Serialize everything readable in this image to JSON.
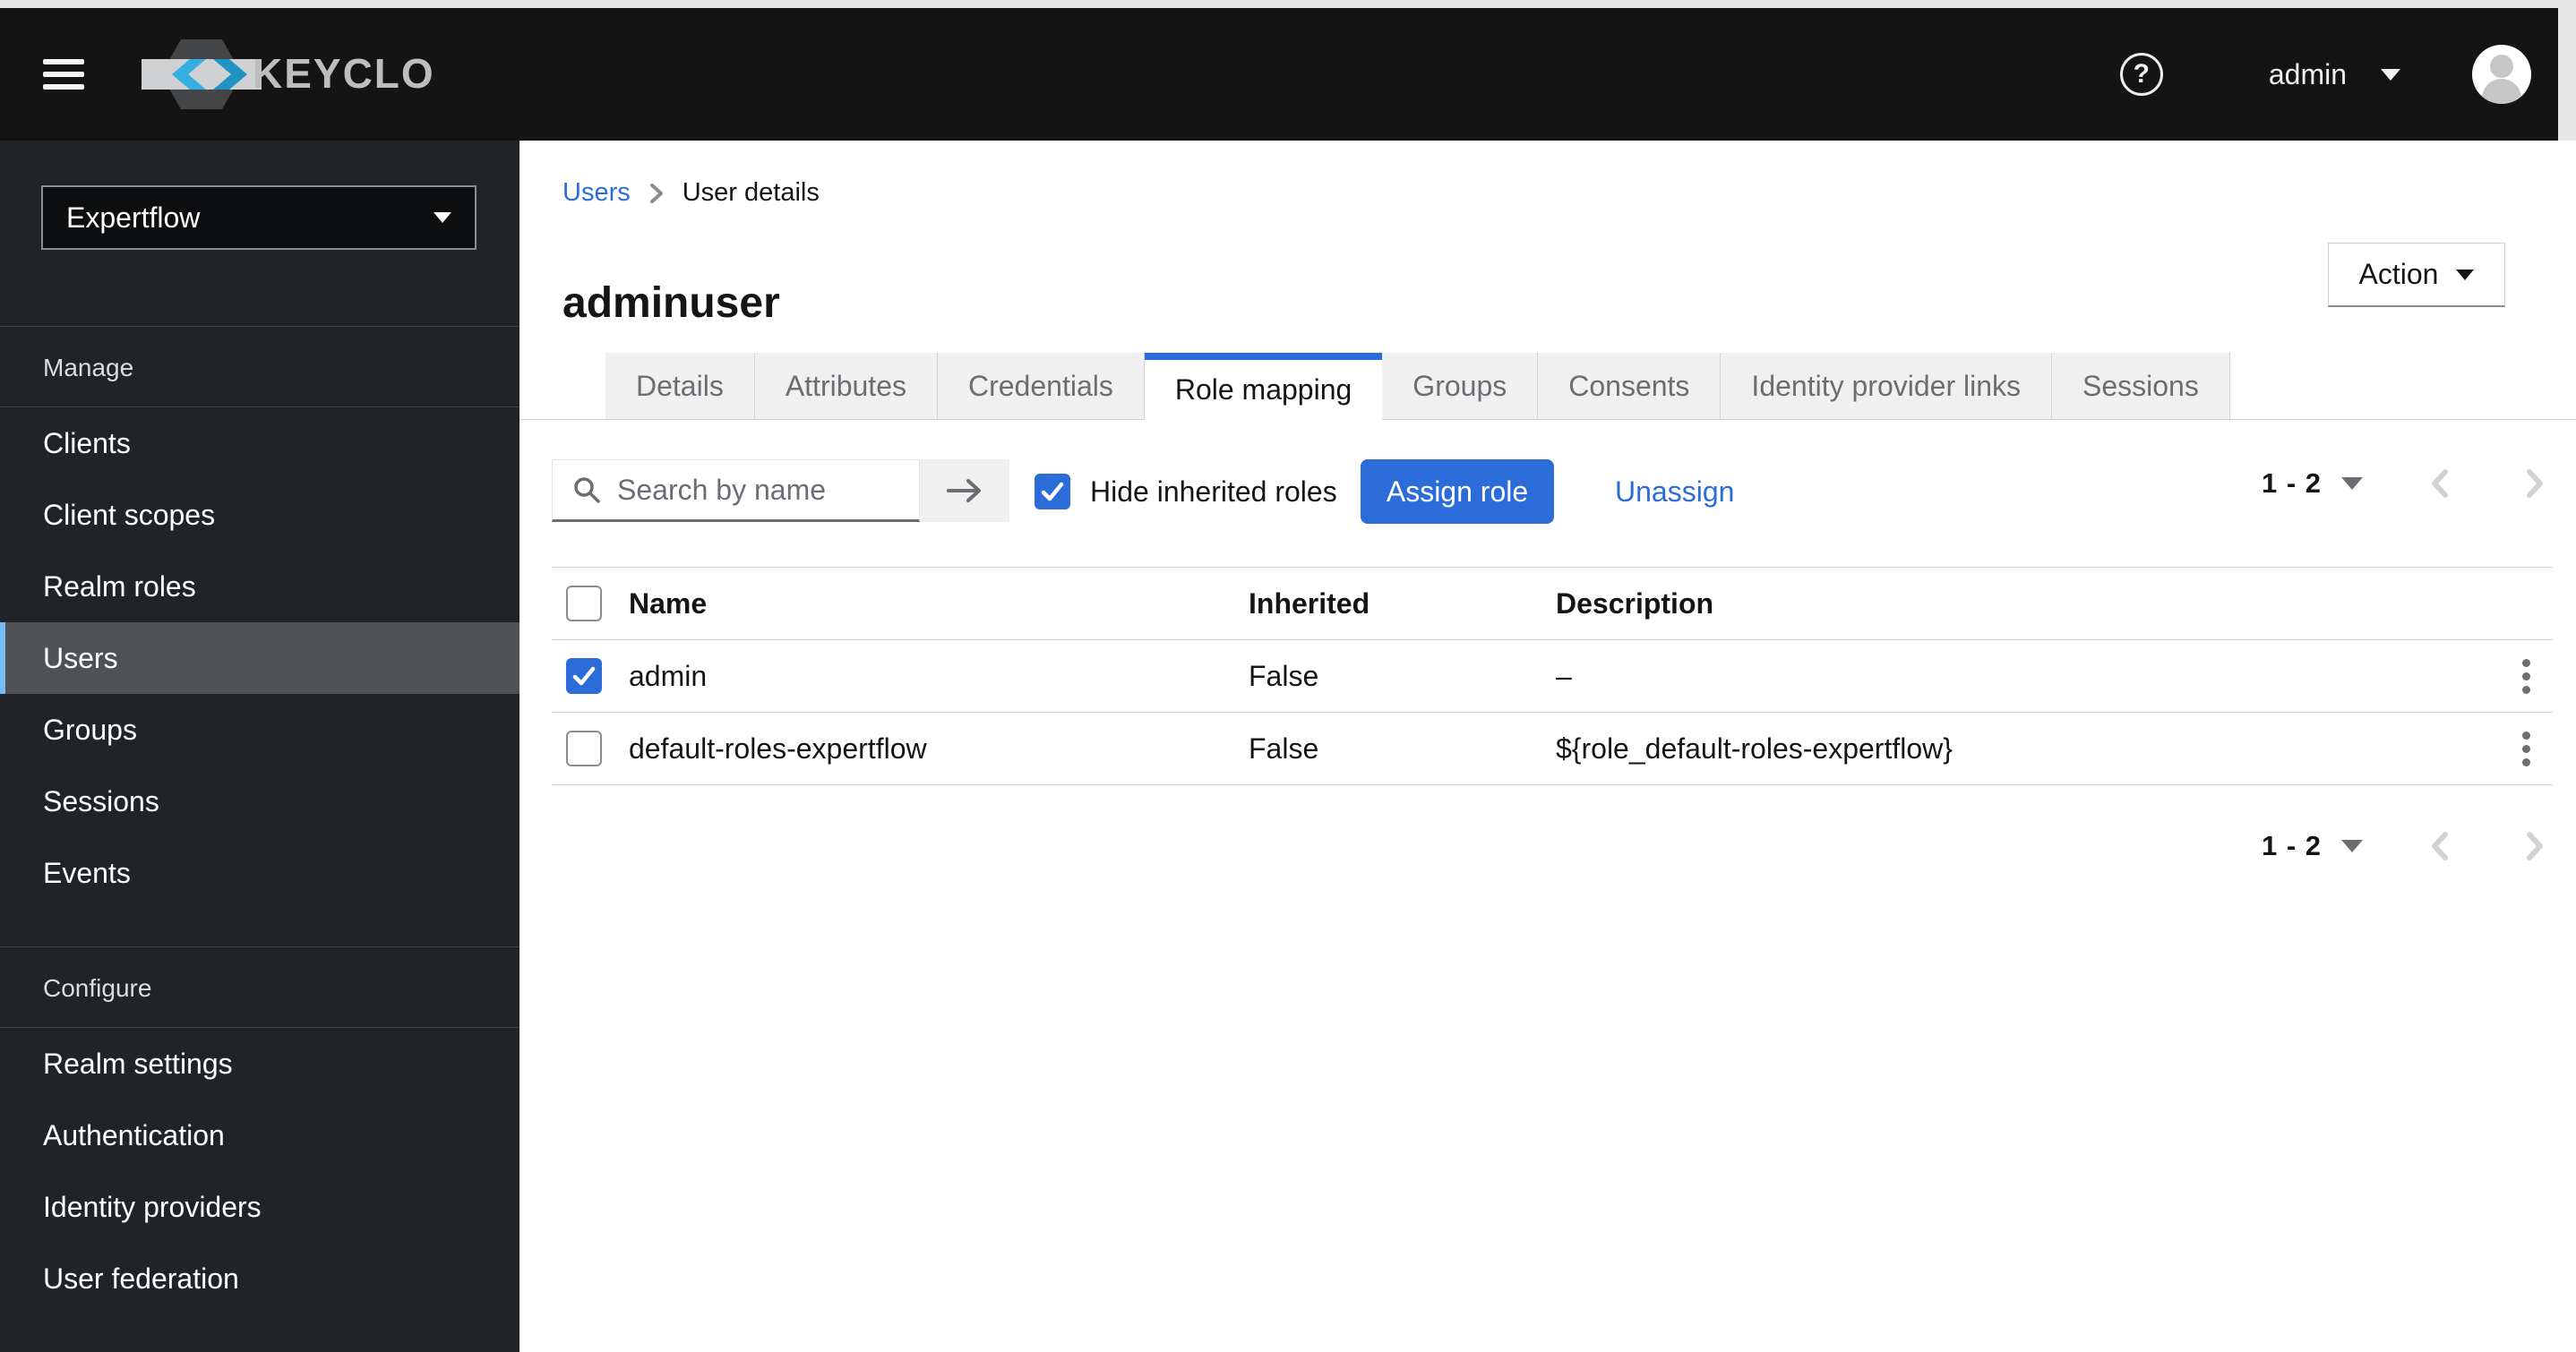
{
  "masthead": {
    "brand": "KEYCLOAK",
    "help_glyph": "?",
    "user": "admin"
  },
  "sidebar": {
    "realm": "Expertflow",
    "groups": [
      {
        "label": "Manage",
        "items": [
          {
            "label": "Clients",
            "active": false
          },
          {
            "label": "Client scopes",
            "active": false
          },
          {
            "label": "Realm roles",
            "active": false
          },
          {
            "label": "Users",
            "active": true
          },
          {
            "label": "Groups",
            "active": false
          },
          {
            "label": "Sessions",
            "active": false
          },
          {
            "label": "Events",
            "active": false
          }
        ]
      },
      {
        "label": "Configure",
        "items": [
          {
            "label": "Realm settings",
            "active": false
          },
          {
            "label": "Authentication",
            "active": false
          },
          {
            "label": "Identity providers",
            "active": false
          },
          {
            "label": "User federation",
            "active": false
          }
        ]
      }
    ]
  },
  "breadcrumb": {
    "parent": "Users",
    "current": "User details"
  },
  "page": {
    "title": "adminuser",
    "action_label": "Action"
  },
  "tabs": [
    {
      "label": "Details",
      "active": false
    },
    {
      "label": "Attributes",
      "active": false
    },
    {
      "label": "Credentials",
      "active": false
    },
    {
      "label": "Role mapping",
      "active": true
    },
    {
      "label": "Groups",
      "active": false
    },
    {
      "label": "Consents",
      "active": false
    },
    {
      "label": "Identity provider links",
      "active": false
    },
    {
      "label": "Sessions",
      "active": false
    }
  ],
  "toolbar": {
    "search_placeholder": "Search by name",
    "hide_inherited_label": "Hide inherited roles",
    "hide_inherited_checked": true,
    "assign_label": "Assign role",
    "unassign_label": "Unassign"
  },
  "pagination": {
    "range": "1 - 2"
  },
  "table": {
    "columns": [
      "Name",
      "Inherited",
      "Description"
    ],
    "rows": [
      {
        "name": "admin",
        "inherited": "False",
        "description": "–",
        "checked": true
      },
      {
        "name": "default-roles-expertflow",
        "inherited": "False",
        "description": "${role_default-roles-expertflow}",
        "checked": false
      }
    ]
  },
  "icons": {
    "menu": "hamburger-icon",
    "help": "question-circle-icon",
    "user_caret": "caret-down-icon",
    "avatar": "user-avatar-icon",
    "search": "magnifier-icon",
    "search_submit": "arrow-right-icon",
    "row_menu": "kebab-icon",
    "pager_prev": "chevron-left-icon",
    "pager_next": "chevron-right-icon"
  },
  "colors": {
    "accent": "#2b6cd9",
    "link": "#2b6cd9",
    "masthead_bg": "#141414",
    "sidebar_bg": "#212427",
    "nav_active_bg": "#4f5255",
    "nav_active_accent": "#73bcf7",
    "tab_inactive_bg": "#f0f0f0",
    "border": "#d2d2d2",
    "muted_text": "#6a6e73"
  }
}
